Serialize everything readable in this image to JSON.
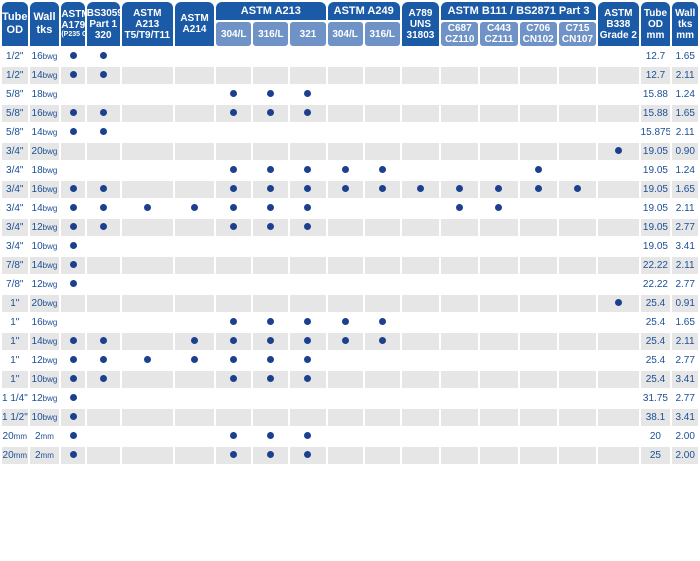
{
  "columns": [
    {
      "key": "od",
      "lines": [
        "Tube",
        "OD"
      ]
    },
    {
      "key": "wt",
      "lines": [
        "Wall",
        "tks"
      ]
    },
    {
      "key": "a179",
      "lines": [
        "ASTM",
        "A179"
      ],
      "small": "(P235 GH)"
    },
    {
      "key": "bs3059",
      "lines": [
        "BS3059",
        "Part 1",
        "320"
      ]
    },
    {
      "key": "a213_t",
      "lines": [
        "ASTM",
        "A213",
        "T5/T9/T11"
      ]
    },
    {
      "key": "a214",
      "lines": [
        "ASTM",
        "A214"
      ]
    },
    {
      "key": "a213_304",
      "group": "ASTM A213",
      "label": "304/L"
    },
    {
      "key": "a213_316",
      "group": "ASTM A213",
      "label": "316/L"
    },
    {
      "key": "a213_321",
      "group": "ASTM A213",
      "label": "321"
    },
    {
      "key": "a249_304",
      "group": "ASTM A249",
      "label": "304/L"
    },
    {
      "key": "a249_316",
      "group": "ASTM A249",
      "label": "316/L"
    },
    {
      "key": "a789",
      "lines": [
        "A789",
        "UNS",
        "31803"
      ]
    },
    {
      "key": "b111_c687",
      "group": "ASTM B111 / BS2871 Part 3",
      "lines": [
        "C687",
        "CZ110"
      ]
    },
    {
      "key": "b111_c443",
      "group": "ASTM B111 / BS2871 Part 3",
      "lines": [
        "C443",
        "CZ111"
      ]
    },
    {
      "key": "b111_c706",
      "group": "ASTM B111 / BS2871 Part 3",
      "lines": [
        "C706",
        "CN102"
      ]
    },
    {
      "key": "b111_c715",
      "group": "ASTM B111 / BS2871 Part 3",
      "lines": [
        "C715",
        "CN107"
      ]
    },
    {
      "key": "b338",
      "lines": [
        "ASTM",
        "B338",
        "Grade 2"
      ]
    },
    {
      "key": "od_mm",
      "lines": [
        "Tube",
        "OD",
        "mm"
      ]
    },
    {
      "key": "wt_mm",
      "lines": [
        "Wall",
        "tks",
        "mm"
      ]
    }
  ],
  "groups": [
    {
      "label": "ASTM A213",
      "span": 3
    },
    {
      "label": "ASTM A249",
      "span": 2
    },
    {
      "label": "ASTM B111 / BS2871 Part 3",
      "span": 4
    }
  ],
  "rows": [
    {
      "od": "1/2\"",
      "wt": "16",
      "wt_unit": "bwg",
      "marks": [
        2,
        3
      ],
      "od_mm": "12.7",
      "wt_mm": "1.65"
    },
    {
      "od": "1/2\"",
      "wt": "14",
      "wt_unit": "bwg",
      "marks": [
        2,
        3
      ],
      "od_mm": "12.7",
      "wt_mm": "2.11"
    },
    {
      "od": "5/8\"",
      "wt": "18",
      "wt_unit": "bwg",
      "marks": [
        6,
        7,
        8
      ],
      "od_mm": "15.88",
      "wt_mm": "1.24"
    },
    {
      "od": "5/8\"",
      "wt": "16",
      "wt_unit": "bwg",
      "marks": [
        2,
        3,
        6,
        7,
        8
      ],
      "od_mm": "15.88",
      "wt_mm": "1.65"
    },
    {
      "od": "5/8\"",
      "wt": "14",
      "wt_unit": "bwg",
      "marks": [
        2,
        3
      ],
      "od_mm": "15.875",
      "wt_mm": "2.11"
    },
    {
      "od": "3/4\"",
      "wt": "20",
      "wt_unit": "bwg",
      "marks": [
        16
      ],
      "od_mm": "19.05",
      "wt_mm": "0.90"
    },
    {
      "od": "3/4\"",
      "wt": "18",
      "wt_unit": "bwg",
      "marks": [
        6,
        7,
        8,
        9,
        10,
        14
      ],
      "od_mm": "19.05",
      "wt_mm": "1.24"
    },
    {
      "od": "3/4\"",
      "wt": "16",
      "wt_unit": "bwg",
      "marks": [
        2,
        3,
        6,
        7,
        8,
        9,
        10,
        11,
        12,
        13,
        14,
        15
      ],
      "od_mm": "19.05",
      "wt_mm": "1.65"
    },
    {
      "od": "3/4\"",
      "wt": "14",
      "wt_unit": "bwg",
      "marks": [
        2,
        3,
        4,
        5,
        6,
        7,
        8,
        12,
        13
      ],
      "od_mm": "19.05",
      "wt_mm": "2.11"
    },
    {
      "od": "3/4\"",
      "wt": "12",
      "wt_unit": "bwg",
      "marks": [
        2,
        3,
        6,
        7,
        8
      ],
      "od_mm": "19.05",
      "wt_mm": "2.77"
    },
    {
      "od": "3/4\"",
      "wt": "10",
      "wt_unit": "bwg",
      "marks": [
        2
      ],
      "od_mm": "19.05",
      "wt_mm": "3.41"
    },
    {
      "od": "7/8\"",
      "wt": "14",
      "wt_unit": "bwg",
      "marks": [
        2
      ],
      "od_mm": "22.22",
      "wt_mm": "2.11"
    },
    {
      "od": "7/8\"",
      "wt": "12",
      "wt_unit": "bwg",
      "marks": [
        2
      ],
      "od_mm": "22.22",
      "wt_mm": "2.77"
    },
    {
      "od": "1\"",
      "wt": "20",
      "wt_unit": "bwg",
      "marks": [
        16
      ],
      "od_mm": "25.4",
      "wt_mm": "0.91"
    },
    {
      "od": "1\"",
      "wt": "16",
      "wt_unit": "bwg",
      "marks": [
        6,
        7,
        8,
        9,
        10
      ],
      "od_mm": "25.4",
      "wt_mm": "1.65"
    },
    {
      "od": "1\"",
      "wt": "14",
      "wt_unit": "bwg",
      "marks": [
        2,
        3,
        5,
        6,
        7,
        8,
        9,
        10
      ],
      "od_mm": "25.4",
      "wt_mm": "2.11"
    },
    {
      "od": "1\"",
      "wt": "12",
      "wt_unit": "bwg",
      "marks": [
        2,
        3,
        4,
        5,
        6,
        7,
        8
      ],
      "od_mm": "25.4",
      "wt_mm": "2.77"
    },
    {
      "od": "1\"",
      "wt": "10",
      "wt_unit": "bwg",
      "marks": [
        2,
        3,
        6,
        7,
        8
      ],
      "od_mm": "25.4",
      "wt_mm": "3.41"
    },
    {
      "od": "1 1/4\"",
      "wt": "12",
      "wt_unit": "bwg",
      "marks": [
        2
      ],
      "od_mm": "31.75",
      "wt_mm": "2.77"
    },
    {
      "od": "1 1/2\"",
      "wt": "10",
      "wt_unit": "bwg",
      "marks": [
        2
      ],
      "od_mm": "38.1",
      "wt_mm": "3.41"
    },
    {
      "od": "20",
      "od_unit": "mm",
      "wt": "2",
      "wt_unit": "mm",
      "marks": [
        2,
        6,
        7,
        8
      ],
      "od_mm": "20",
      "wt_mm": "2.00"
    },
    {
      "od": "20",
      "od_unit": "mm",
      "wt": "2",
      "wt_unit": "mm",
      "marks": [
        2,
        6,
        7,
        8
      ],
      "od_mm": "25",
      "wt_mm": "2.00"
    }
  ],
  "colors": {
    "header": "#1b5aa6",
    "subheader": "#6f93c6",
    "dot": "#1c3f8f",
    "stripe": "#e6e6e6",
    "text": "#1b4f96"
  }
}
